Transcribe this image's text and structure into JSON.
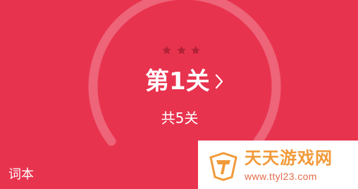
{
  "theme": {
    "background": "#e8334f",
    "ring_track": "#ee6479",
    "star_color": "#b12237",
    "text_color": "#ffffff",
    "watermark_orange": "#f19a3a",
    "watermark_red": "#e36b4a"
  },
  "level_card": {
    "stars_total": 3,
    "stars_earned": 0,
    "title": "第1关",
    "chevron_icon": "chevron-right-icon",
    "count_label": "共5关"
  },
  "bottom": {
    "wordbook_label": "词本"
  },
  "watermark": {
    "name": "天天游戏网",
    "url": "www.ttyl23.com",
    "logo_icon": "watermark-logo-icon"
  }
}
